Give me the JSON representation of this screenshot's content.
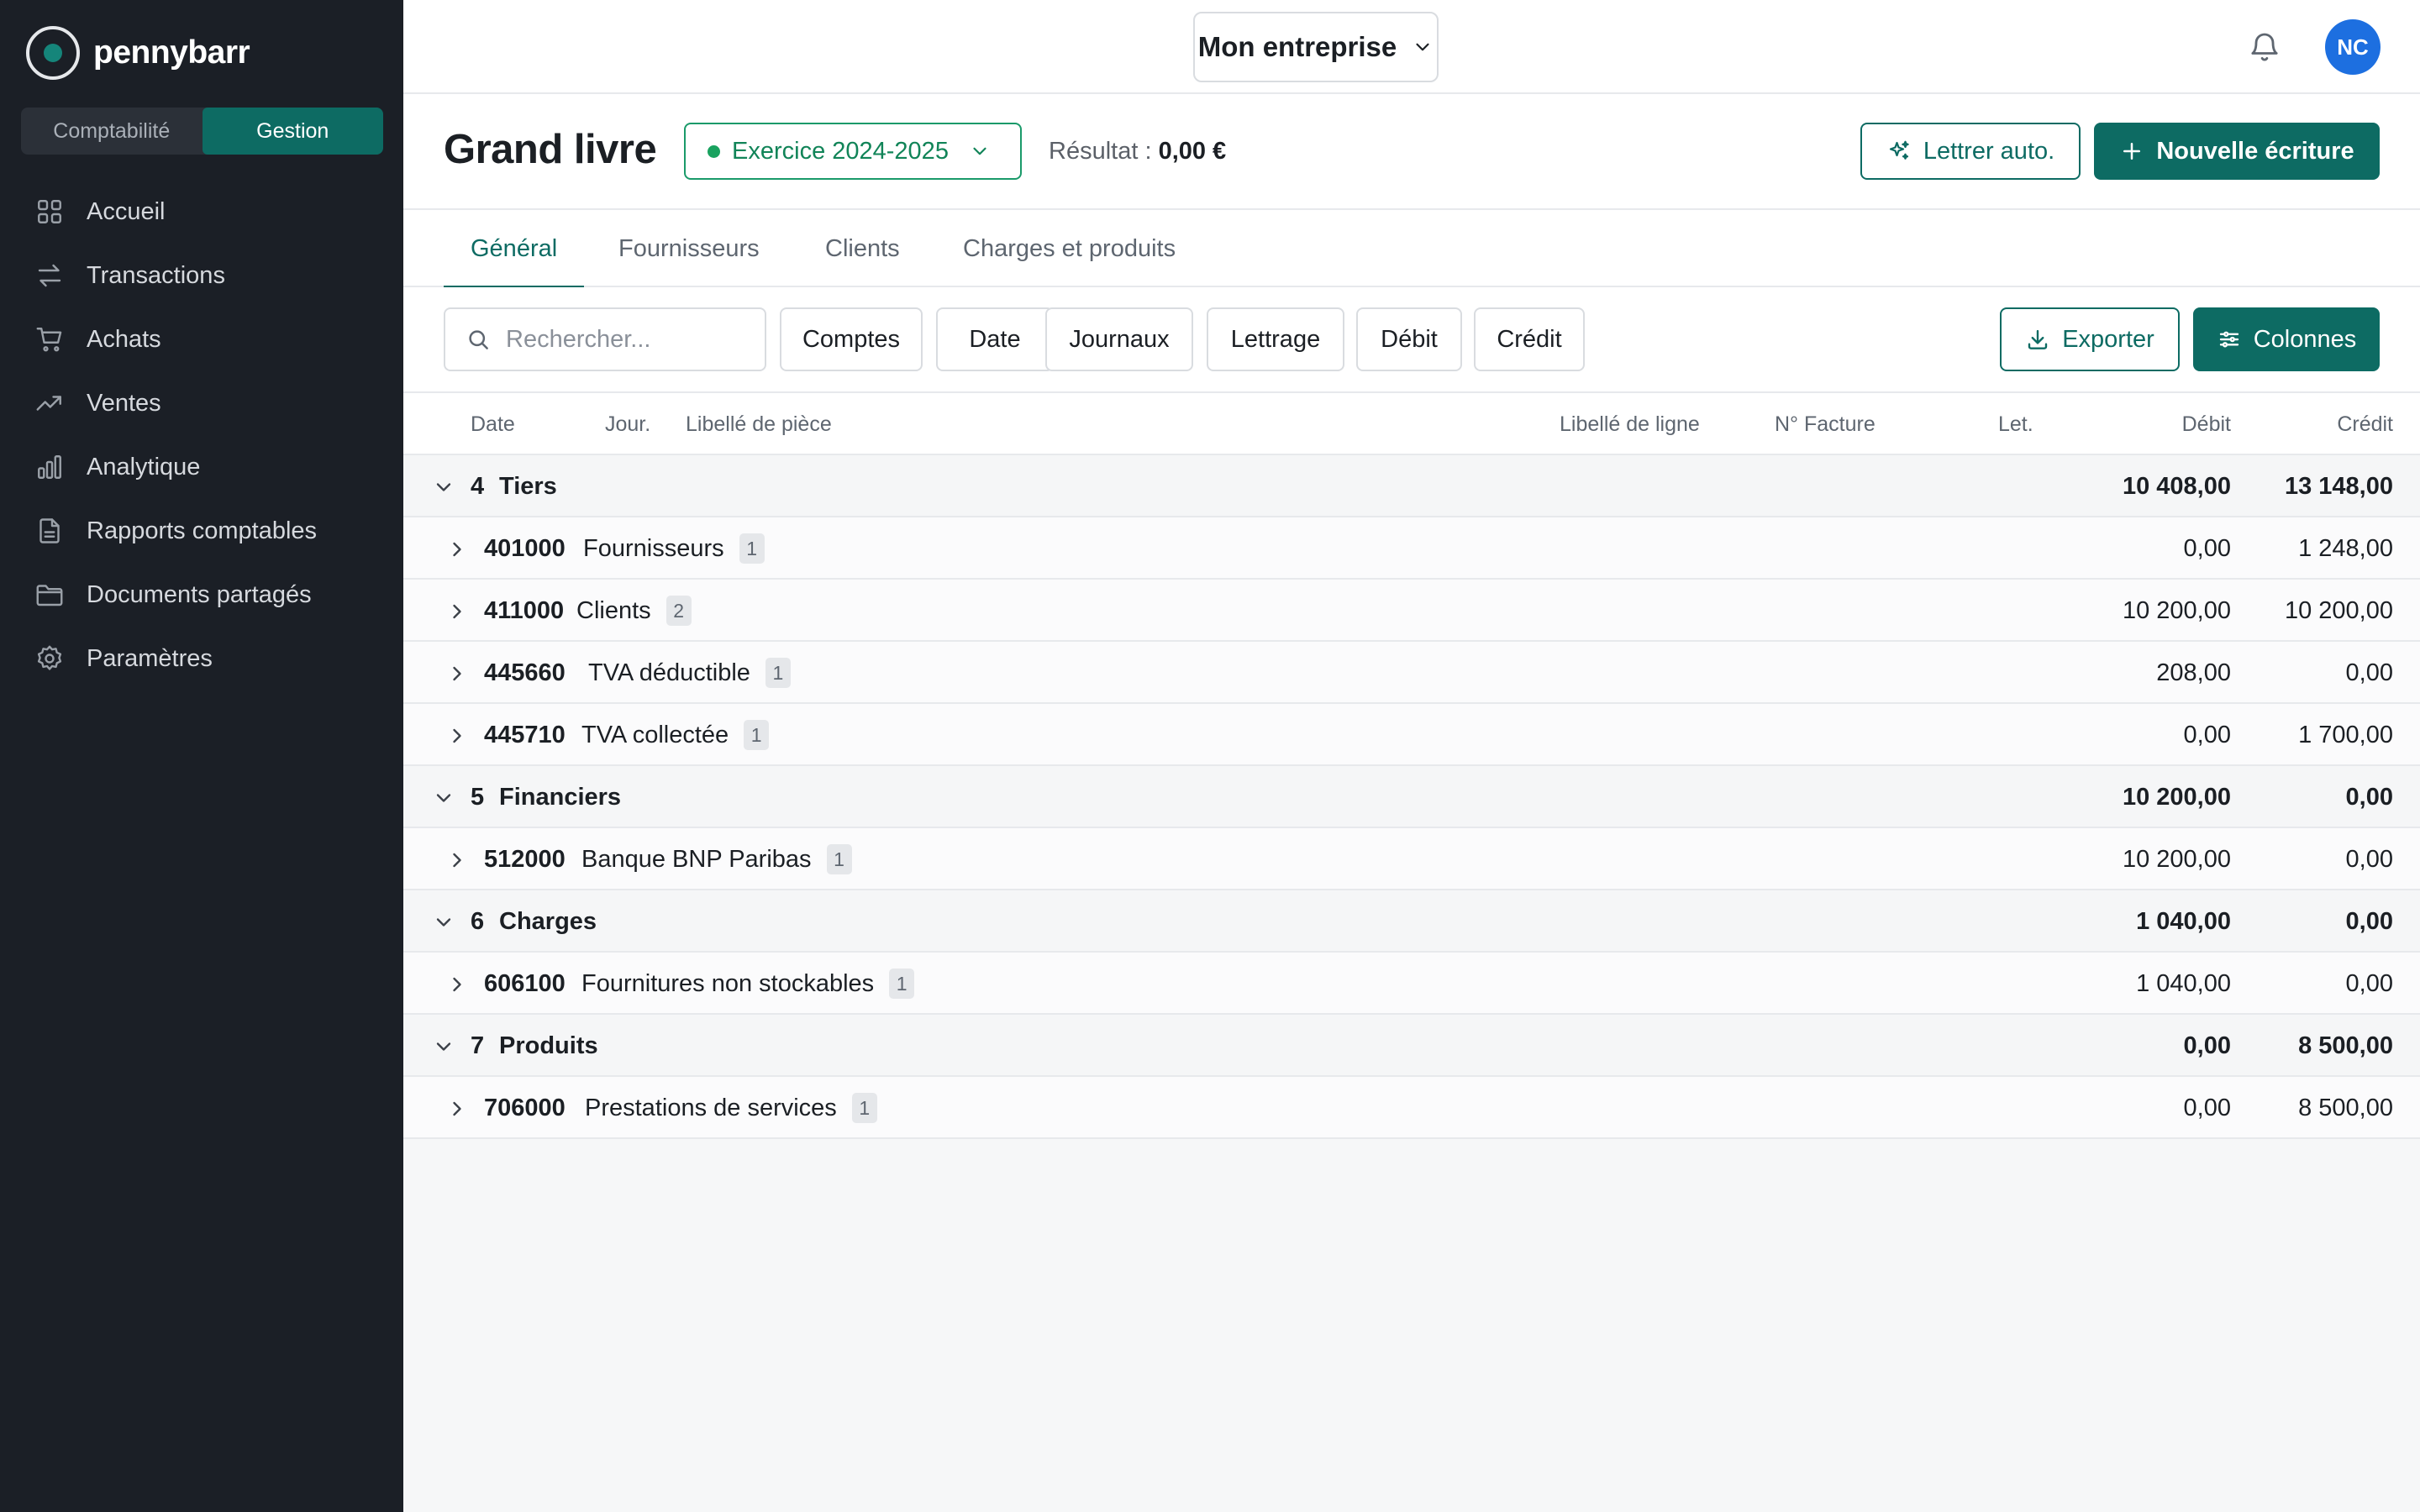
{
  "app": {
    "name": "pennybarr"
  },
  "mode_switch": {
    "left": "Comptabilité",
    "right": "Gestion",
    "active": "Gestion"
  },
  "nav": [
    {
      "label": "Accueil",
      "icon": "grid-icon"
    },
    {
      "label": "Transactions",
      "icon": "transfer-arrows-icon"
    },
    {
      "label": "Achats",
      "icon": "shopping-cart-icon"
    },
    {
      "label": "Ventes",
      "icon": "trend-up-icon"
    },
    {
      "label": "Analytique",
      "icon": "bar-chart-icon"
    },
    {
      "label": "Rapports comptables",
      "icon": "document-icon"
    },
    {
      "label": "Documents partagés",
      "icon": "folder-icon"
    },
    {
      "label": "Paramètres",
      "icon": "gear-icon"
    }
  ],
  "topbar": {
    "company": "Mon entreprise",
    "avatar_initials": "NC"
  },
  "header": {
    "title": "Grand livre",
    "exercise": "Exercice 2024-2025",
    "result_label": "Résultat :",
    "result_value": "0,00 €",
    "auto_letter": "Lettrer auto.",
    "new_entry": "Nouvelle écriture"
  },
  "tabs": [
    "Général",
    "Fournisseurs",
    "Clients",
    "Charges et produits"
  ],
  "active_tab": "Général",
  "filters": {
    "search_placeholder": "Rechercher...",
    "chips": [
      "Comptes",
      "Date",
      "Journaux",
      "Lettrage",
      "Débit",
      "Crédit"
    ],
    "export": "Exporter",
    "columns": "Colonnes"
  },
  "table": {
    "headers": {
      "date": "Date",
      "journal": "Jour.",
      "piece_label": "Libellé de pièce",
      "line_label": "Libellé de ligne",
      "invoice": "N° Facture",
      "letter": "Let.",
      "debit": "Débit",
      "credit": "Crédit"
    },
    "rows": [
      {
        "type": "group",
        "num": "4",
        "name": "Tiers",
        "debit": "10 408,00",
        "credit": "13 148,00"
      },
      {
        "type": "account",
        "num": "401000",
        "name": "Fournisseurs",
        "count": "1",
        "debit": "0,00",
        "credit": "1 248,00"
      },
      {
        "type": "account",
        "num": "411000",
        "name": "Clients",
        "count": "2",
        "debit": "10 200,00",
        "credit": "10 200,00"
      },
      {
        "type": "account",
        "num": "445660",
        "name": "TVA déductible",
        "count": "1",
        "debit": "208,00",
        "credit": "0,00"
      },
      {
        "type": "account",
        "num": "445710",
        "name": "TVA collectée",
        "count": "1",
        "debit": "0,00",
        "credit": "1 700,00"
      },
      {
        "type": "group",
        "num": "5",
        "name": "Financiers",
        "debit": "10 200,00",
        "credit": "0,00"
      },
      {
        "type": "account",
        "num": "512000",
        "name": "Banque BNP Paribas",
        "count": "1",
        "debit": "10 200,00",
        "credit": "0,00"
      },
      {
        "type": "group",
        "num": "6",
        "name": "Charges",
        "debit": "1 040,00",
        "credit": "0,00"
      },
      {
        "type": "account",
        "num": "606100",
        "name": "Fournitures non stockables",
        "count": "1",
        "debit": "1 040,00",
        "credit": "0,00"
      },
      {
        "type": "group",
        "num": "7",
        "name": "Produits",
        "debit": "0,00",
        "credit": "8 500,00"
      },
      {
        "type": "account",
        "num": "706000",
        "name": "Prestations de services",
        "count": "1",
        "debit": "0,00",
        "credit": "8 500,00"
      }
    ]
  },
  "colors": {
    "accent": "#0d6b63",
    "sidebar": "#1b1f26",
    "exercise_green": "#118458",
    "avatar": "#1d6fe0"
  }
}
